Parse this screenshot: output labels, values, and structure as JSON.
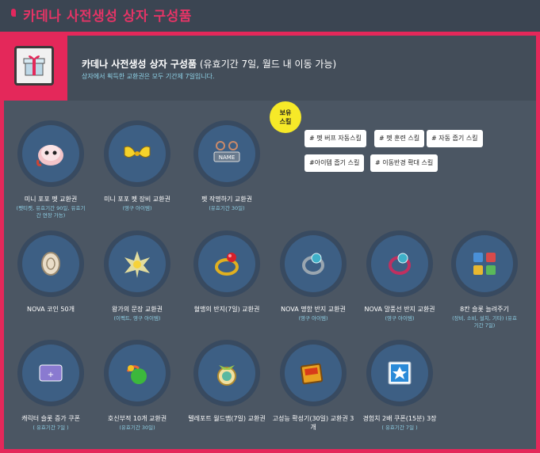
{
  "page_title": "카데나 사전생성 상자 구성품",
  "header": {
    "title_bold": "카데나 사전생성 상자 구성품",
    "title_rest": " (유효기간 7일, 월드 내 이동 가능)",
    "subtitle": "상자에서 획득한 교환권은 모두 기간제 7일입니다."
  },
  "items": [
    {
      "label": "미니 포포 펫 교환권",
      "note": "(펫티켓, 유효기간 90일, 유효기간 연장 가능)",
      "icon": "pet-icon"
    },
    {
      "label": "미니 포포 펫 장비 교환권",
      "note": "(영구 아이템)",
      "icon": "pet-equip-icon"
    },
    {
      "label": "펫 작명하기 교환권",
      "note": "(유효기간 30일)",
      "icon": "name-tag-icon"
    },
    {
      "label": "NOVA 코인 50개",
      "note": "",
      "icon": "coin-icon"
    },
    {
      "label": "왕가의 문장 교환권",
      "note": "(이펙트, 영구 아이템)",
      "icon": "crest-icon"
    },
    {
      "label": "혈맹의 반지(7일) 교환권",
      "note": "",
      "icon": "blood-ring-icon"
    },
    {
      "label": "NOVA 명함 반지 교환권",
      "note": "(영구 아이템)",
      "icon": "card-ring-icon"
    },
    {
      "label": "NOVA 말풍선 반지 교환권",
      "note": "(영구 아이템)",
      "icon": "bubble-ring-icon"
    },
    {
      "label": "8칸 슬롯 늘려주기",
      "note": "(장비, 소비, 설치, 기타) (유효기간 7일)",
      "icon": "slot-icon"
    },
    {
      "label": "캐릭터 슬롯 증가 쿠폰",
      "note": "( 유효기간 7일 )",
      "icon": "character-slot-icon"
    },
    {
      "label": "호신부적 10개 교환권",
      "note": "(유효기간 30일)",
      "icon": "charm-icon"
    },
    {
      "label": "텔레포트 월드맵(7일) 교환권",
      "note": "",
      "icon": "teleport-icon"
    },
    {
      "label": "고성능 확성기(30일) 교환권 3개",
      "note": "",
      "icon": "megaphone-icon"
    },
    {
      "label": "경험치 2배 쿠폰(15분) 3장",
      "note": "( 유효기간 7일 )",
      "icon": "exp-coupon-icon"
    }
  ],
  "skills": {
    "bubble": "보유\n스킬",
    "tags": [
      "# 펫 버프 자동스킬",
      "# 펫 훈련 스킬",
      "# 자동 줍기 스킬",
      "#아이템 줍기 스킬",
      "# 이동반경 확대 스킬"
    ]
  },
  "colors": {
    "accent": "#e4285a",
    "panel": "#4b5663",
    "circle": "#3d5f84",
    "note": "#8fd0e6"
  }
}
